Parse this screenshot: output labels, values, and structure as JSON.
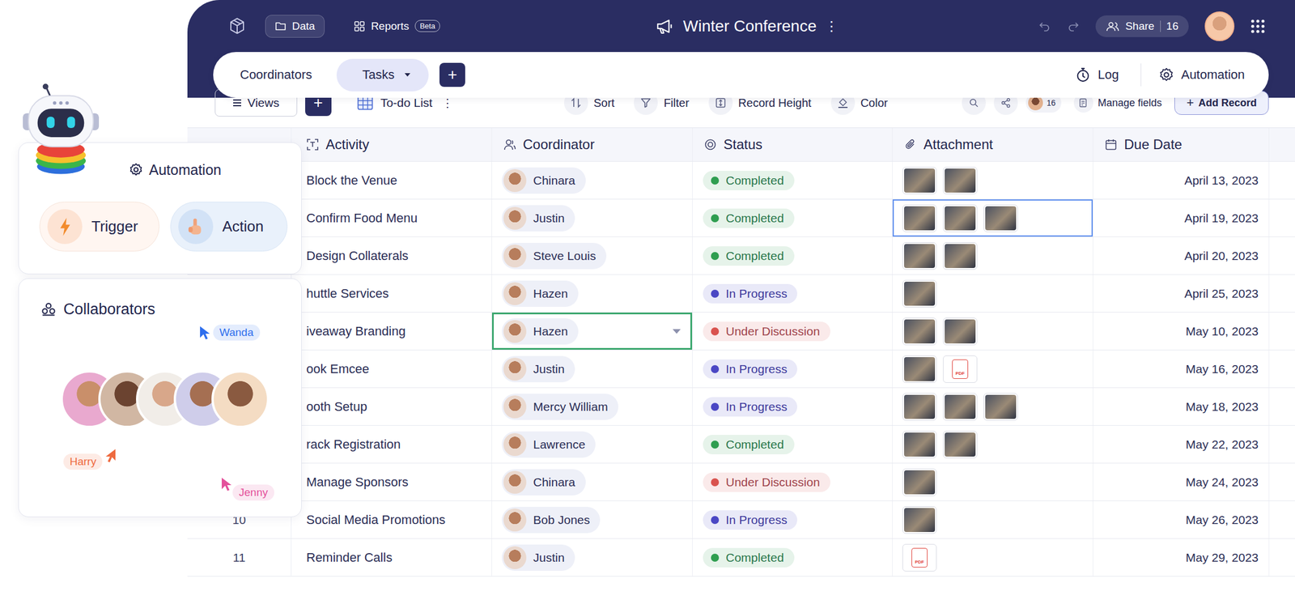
{
  "header": {
    "nav": [
      {
        "label": "Data",
        "selected": true
      },
      {
        "label": "Reports",
        "selected": false,
        "badge": "Beta"
      }
    ],
    "title": "Winter Conference",
    "title_menu": "⋮",
    "share": {
      "label": "Share",
      "count": "16"
    }
  },
  "tabs": [
    {
      "label": "Coordinators",
      "selected": false
    },
    {
      "label": "Tasks",
      "selected": true
    }
  ],
  "add_tab": "+",
  "tab_actions": [
    "Log",
    "Automation"
  ],
  "toolbar": {
    "views": "Views",
    "add": "+",
    "view_name": "To-do List",
    "view_menu": "⋮",
    "tools": [
      "Sort",
      "Filter",
      "Record Height",
      "Color"
    ],
    "viewers": "16",
    "manage_fields": "Manage fields",
    "add_record_icon": "+",
    "add_record": "Add Record"
  },
  "table": {
    "columns": [
      {
        "label": "Activity",
        "kind": "text"
      },
      {
        "label": "Coordinator",
        "kind": "person"
      },
      {
        "label": "Status",
        "kind": "status"
      },
      {
        "label": "Attachment",
        "kind": "attachment"
      },
      {
        "label": "Due Date",
        "kind": "date"
      }
    ],
    "rows": [
      {
        "activity": "Block the Venue",
        "coordinator": "Chinara",
        "coordinator_editing": false,
        "status": {
          "label": "Completed",
          "color": "#2f9e50"
        },
        "attachments": [
          {
            "kind": "image"
          },
          {
            "kind": "image"
          }
        ],
        "attachment_selected": false,
        "due": "April 13, 2023"
      },
      {
        "activity": "Confirm Food Menu",
        "coordinator": "Justin",
        "coordinator_editing": false,
        "status": {
          "label": "Completed",
          "color": "#2f9e50"
        },
        "attachments": [
          {
            "kind": "image"
          },
          {
            "kind": "image"
          },
          {
            "kind": "image"
          }
        ],
        "attachment_selected": true,
        "due": "April 19, 2023"
      },
      {
        "activity": "Design Collaterals",
        "coordinator": "Steve Louis",
        "coordinator_editing": false,
        "status": {
          "label": "Completed",
          "color": "#2f9e50"
        },
        "attachments": [
          {
            "kind": "image"
          },
          {
            "kind": "image"
          }
        ],
        "attachment_selected": false,
        "due": "April 20, 2023"
      },
      {
        "activity": "huttle Services",
        "coordinator": "Hazen",
        "coordinator_editing": false,
        "status": {
          "label": "In Progress",
          "color": "#4b47c4"
        },
        "attachments": [
          {
            "kind": "image"
          }
        ],
        "attachment_selected": false,
        "due": "April 25, 2023"
      },
      {
        "activity": "iveaway Branding",
        "coordinator": "Hazen",
        "coordinator_editing": true,
        "status": {
          "label": "Under Discussion",
          "color": "#d9534f"
        },
        "attachments": [
          {
            "kind": "image"
          },
          {
            "kind": "image"
          }
        ],
        "attachment_selected": false,
        "due": "May 10, 2023"
      },
      {
        "activity": "ook Emcee",
        "coordinator": "Justin",
        "coordinator_editing": false,
        "status": {
          "label": "In Progress",
          "color": "#4b47c4"
        },
        "attachments": [
          {
            "kind": "image"
          },
          {
            "kind": "pdf",
            "label": "PDF"
          }
        ],
        "attachment_selected": false,
        "due": "May 16, 2023"
      },
      {
        "activity": "ooth Setup",
        "coordinator": "Mercy William",
        "coordinator_editing": false,
        "status": {
          "label": "In Progress",
          "color": "#4b47c4"
        },
        "attachments": [
          {
            "kind": "image"
          },
          {
            "kind": "image"
          },
          {
            "kind": "image"
          }
        ],
        "attachment_selected": false,
        "due": "May 18, 2023"
      },
      {
        "activity": "rack Registration",
        "coordinator": "Lawrence",
        "coordinator_editing": false,
        "status": {
          "label": "Completed",
          "color": "#2f9e50"
        },
        "attachments": [
          {
            "kind": "image"
          },
          {
            "kind": "image"
          }
        ],
        "attachment_selected": false,
        "due": "May 22, 2023"
      },
      {
        "activity": "Manage Sponsors",
        "coordinator": "Chinara",
        "coordinator_editing": false,
        "status": {
          "label": "Under Discussion",
          "color": "#d9534f"
        },
        "attachments": [
          {
            "kind": "image"
          }
        ],
        "attachment_selected": false,
        "due": "May 24, 2023"
      },
      {
        "num": "10",
        "activity": "Social Media Promotions",
        "coordinator": "Bob Jones",
        "coordinator_editing": false,
        "status": {
          "label": "In Progress",
          "color": "#4b47c4"
        },
        "attachments": [
          {
            "kind": "image"
          }
        ],
        "attachment_selected": false,
        "due": "May 26, 2023"
      },
      {
        "num": "11",
        "activity": "Reminder Calls",
        "coordinator": "Justin",
        "coordinator_editing": false,
        "status": {
          "label": "Completed",
          "color": "#2f9e50"
        },
        "attachments": [
          {
            "kind": "pdf",
            "label": "PDF"
          }
        ],
        "attachment_selected": false,
        "due": "May 29, 2023"
      }
    ]
  },
  "automation": {
    "title": "Automation",
    "trigger": "Trigger",
    "action": "Action"
  },
  "collaborators": {
    "title": "Collaborators",
    "avatar_count": 5,
    "cursors": [
      {
        "name": "Wanda",
        "color": "#2f6fed"
      },
      {
        "name": "Harry",
        "color": "#ee6a3f"
      },
      {
        "name": "Jenny",
        "color": "#e4519b"
      }
    ]
  }
}
